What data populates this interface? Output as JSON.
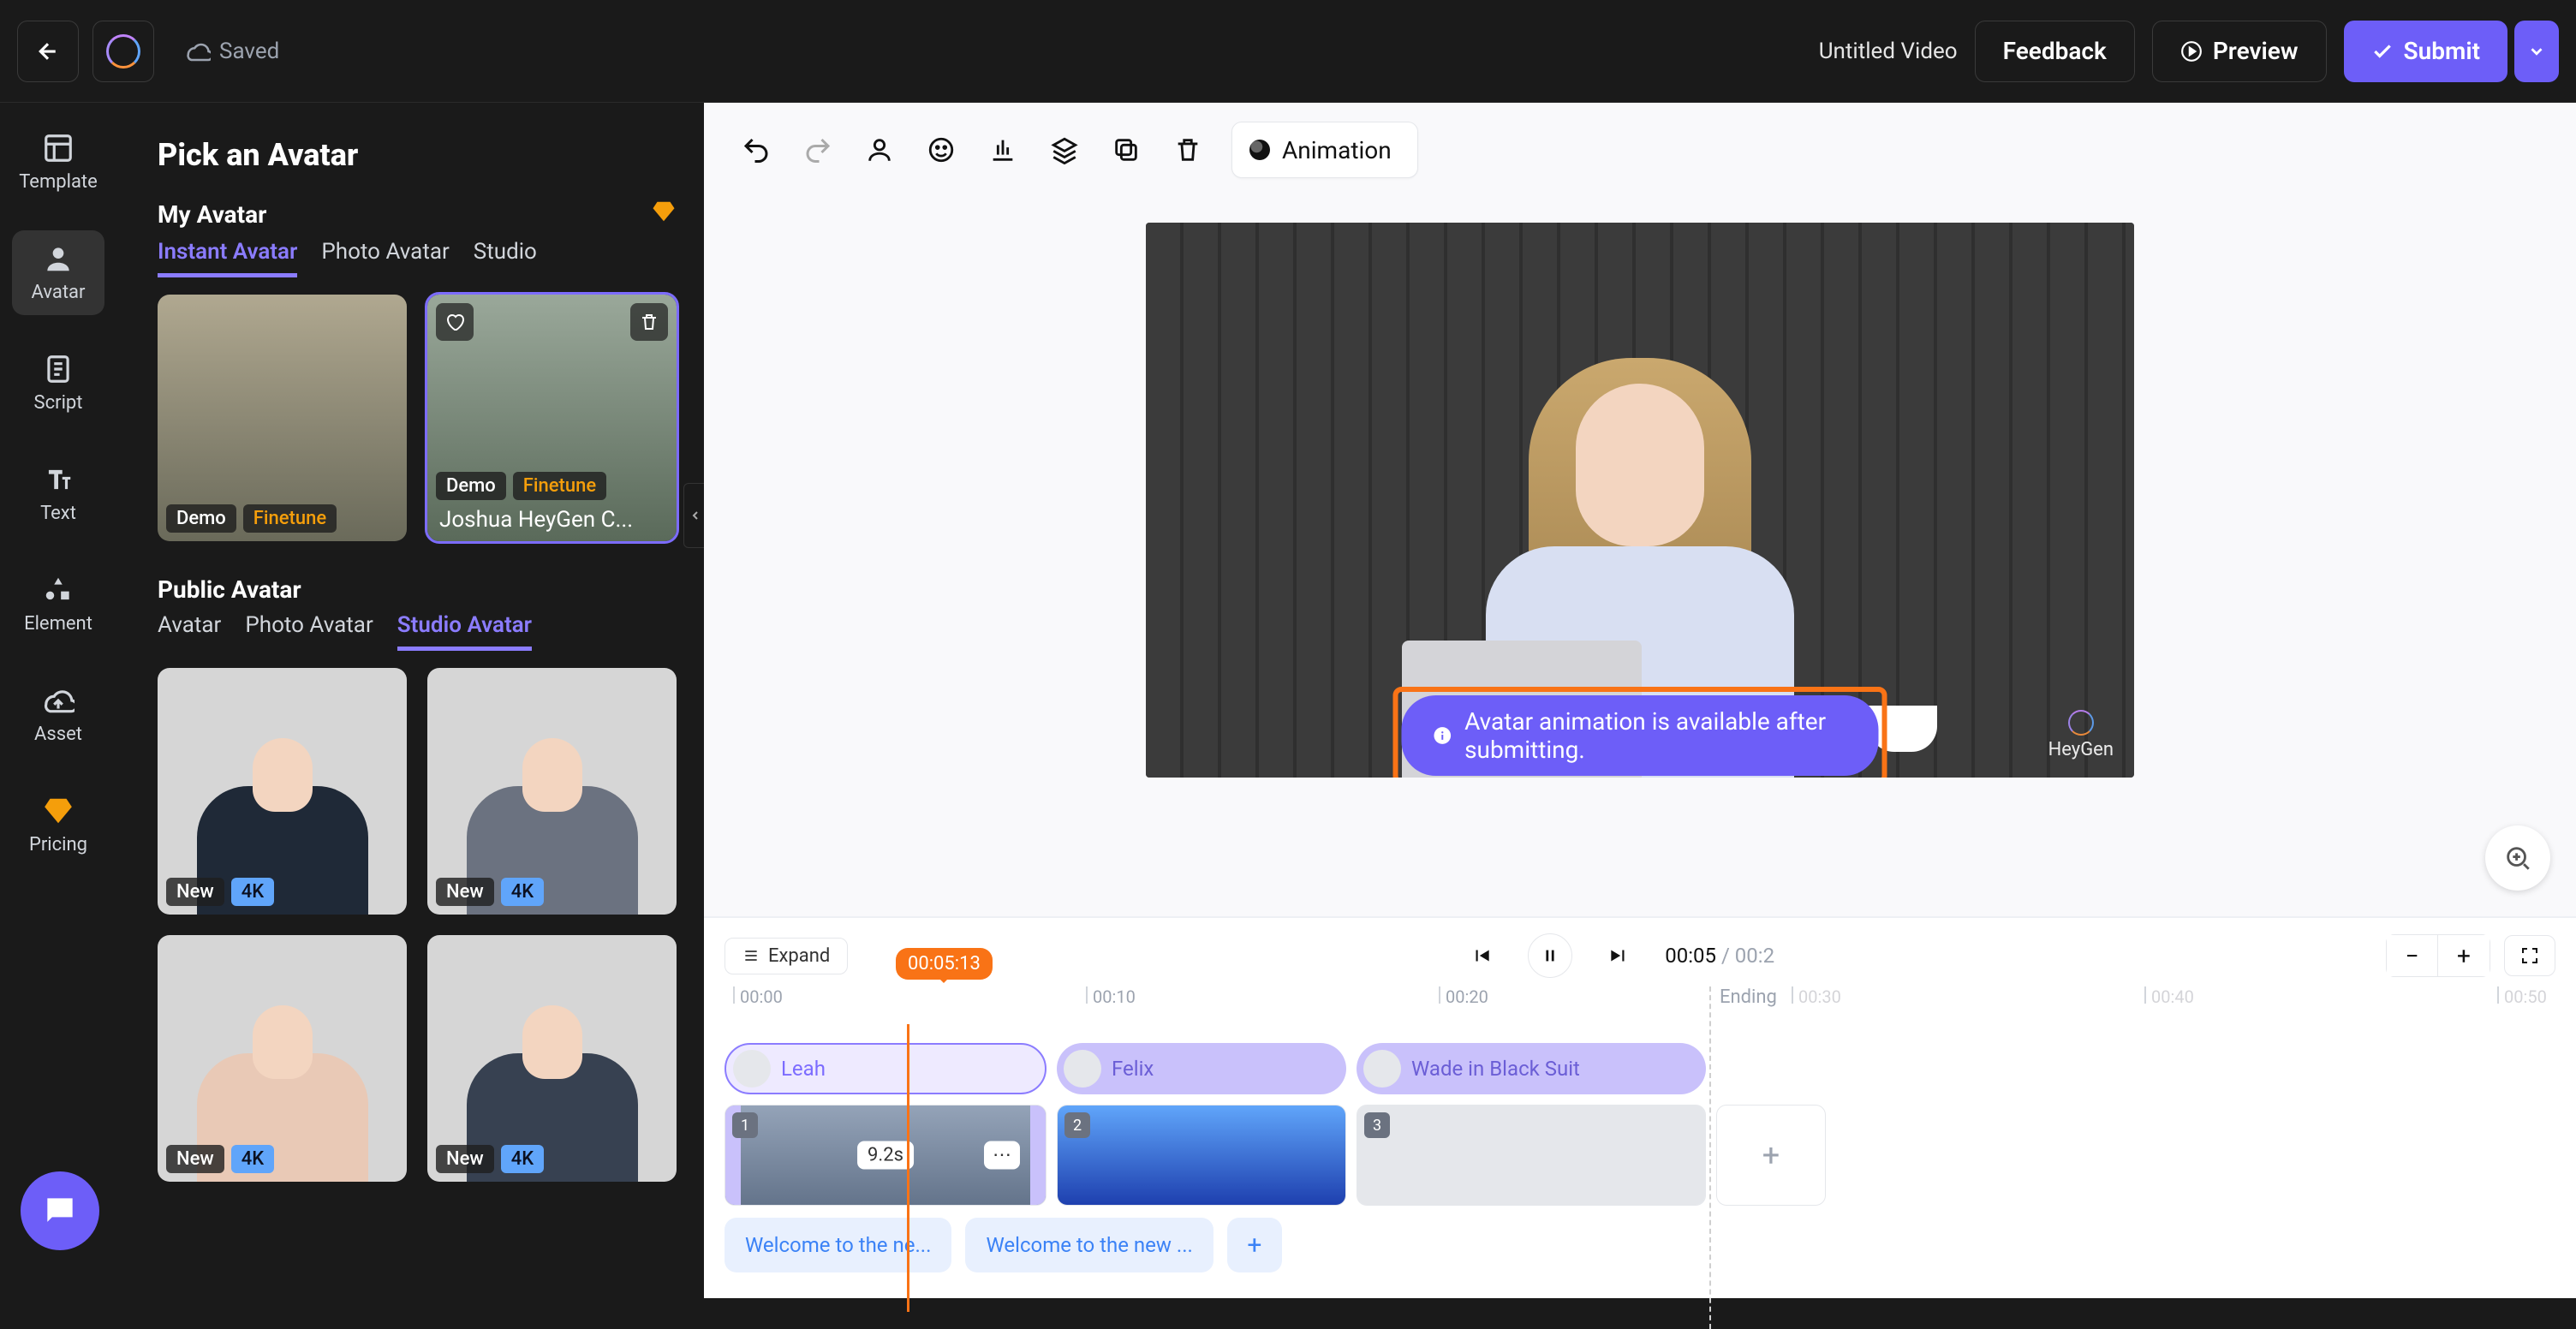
{
  "topbar": {
    "saved": "Saved",
    "title": "Untitled Video",
    "feedback": "Feedback",
    "preview": "Preview",
    "submit": "Submit"
  },
  "vtabs": {
    "template": "Template",
    "avatar": "Avatar",
    "script": "Script",
    "text": "Text",
    "element": "Element",
    "asset": "Asset",
    "pricing": "Pricing"
  },
  "panel": {
    "title": "Pick an Avatar",
    "my_avatar": "My Avatar",
    "my_tabs": {
      "instant": "Instant Avatar",
      "photo": "Photo Avatar",
      "studio": "Studio"
    },
    "cards": {
      "c1": {
        "demo": "Demo",
        "finetune": "Finetune"
      },
      "c2": {
        "demo": "Demo",
        "finetune": "Finetune",
        "name": "Joshua HeyGen C..."
      }
    },
    "public_avatar": "Public Avatar",
    "pub_tabs": {
      "avatar": "Avatar",
      "photo": "Photo Avatar",
      "studio": "Studio Avatar"
    },
    "pcards": {
      "p1": {
        "new": "New",
        "res": "4K"
      },
      "p2": {
        "new": "New",
        "res": "4K"
      },
      "p3": {
        "new": "New",
        "res": "4K"
      },
      "p4": {
        "new": "New",
        "res": "4K"
      }
    }
  },
  "toolbar": {
    "animation": "Animation"
  },
  "notice": "Avatar animation is available after submitting.",
  "brand": "HeyGen",
  "timeline": {
    "expand": "Expand",
    "playhead": "00:05:13",
    "current": "00:05",
    "total": "/ 00:2",
    "marks": [
      "00:00",
      "00:10",
      "00:20",
      "00:30",
      "00:40",
      "00:50"
    ],
    "ending": "Ending",
    "clips": {
      "leah": "Leah",
      "felix": "Felix",
      "wade": "Wade in Black Suit"
    },
    "clip_numbers": {
      "one": "1",
      "two": "2",
      "three": "3"
    },
    "dur1": "9.2s",
    "texts": {
      "t1": "Welcome to the ne...",
      "t2": "Welcome to the new ..."
    }
  }
}
